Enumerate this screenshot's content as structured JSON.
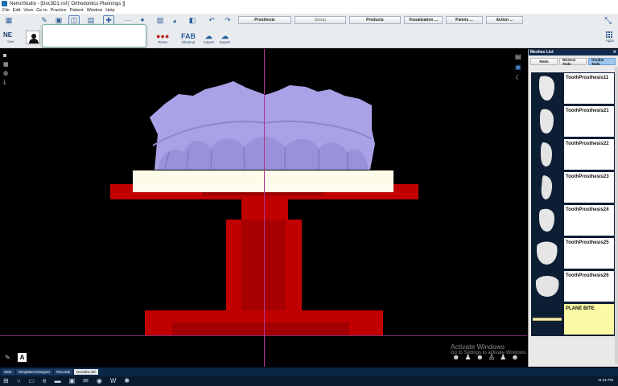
{
  "window": {
    "title": "NemoStudio - [Doc3D1.nsf [ Orthodontics Plannings ]]"
  },
  "menu": [
    "File",
    "Edit",
    "View",
    "Go to",
    "Practice",
    "Patient",
    "Window",
    "Help"
  ],
  "toolbar": {
    "tabs": [
      {
        "label": "Prosthesis",
        "disabled": false
      },
      {
        "label": "Setup",
        "disabled": true
      },
      {
        "label": "Products",
        "disabled": false
      },
      {
        "label": "Visualization ...",
        "disabled": false
      },
      {
        "label": "Panels ...",
        "disabled": false
      },
      {
        "label": "Action ...",
        "disabled": false
      }
    ],
    "ne_logo": "NE",
    "ne_sub": "Start",
    "press_label": "Press",
    "fab_label": "FAB",
    "shortcut_label": "Shortcut",
    "import_label": "Import",
    "export_label": "Export",
    "apps_label": "Apps"
  },
  "panel": {
    "title": "Meshes List",
    "buttons": [
      {
        "label": "Redo",
        "active": false
      },
      {
        "label": "Mostrar Todo",
        "active": false
      },
      {
        "label": "Ocultar Todo",
        "active": true
      }
    ],
    "meshes": [
      {
        "label": "ToothProsthesis11",
        "selected": false,
        "icon": "tooth-icon"
      },
      {
        "label": "ToothProsthesis21",
        "selected": false,
        "icon": "tooth-icon"
      },
      {
        "label": "ToothProsthesis22",
        "selected": false,
        "icon": "tooth-icon"
      },
      {
        "label": "ToothProsthesis23",
        "selected": false,
        "icon": "tooth-icon"
      },
      {
        "label": "ToothProsthesis24",
        "selected": false,
        "icon": "tooth-icon"
      },
      {
        "label": "ToothProsthesis25",
        "selected": false,
        "icon": "tooth-icon"
      },
      {
        "label": "ToothProsthesis26",
        "selected": false,
        "icon": "tooth-icon"
      },
      {
        "label": "PLANE BITE",
        "selected": true,
        "icon": "plane-icon"
      }
    ]
  },
  "viewport": {
    "a_label": "A",
    "watermark_title": "Activate Windows",
    "watermark_sub": "Go to Settings to activate Windows."
  },
  "doc_tabs": [
    {
      "label": "Start",
      "active": false
    },
    {
      "label": "Templates Designer",
      "active": false
    },
    {
      "label": "Records",
      "active": false
    },
    {
      "label": "Doc3D1.nsf",
      "active": true
    }
  ],
  "taskbar": {
    "time": "11:01 PM"
  },
  "colors": {
    "model": "#a9a2e6",
    "stand": "#c10000",
    "plate": "#fdfbe9",
    "panel_header": "#0f2a4c"
  }
}
